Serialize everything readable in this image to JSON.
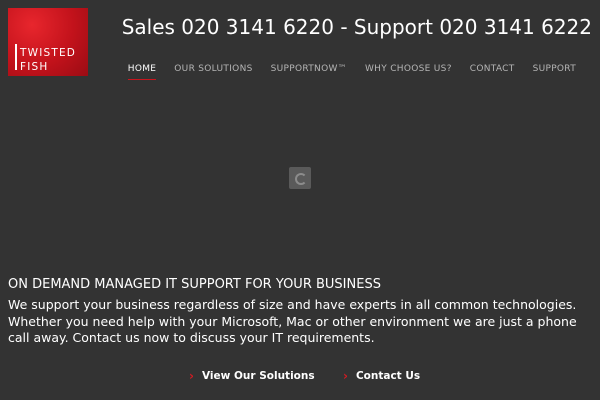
{
  "brand": {
    "logo_line1": "TWISTED",
    "logo_line2": "FISH",
    "color": "#c2121b"
  },
  "header": {
    "phone_text": "Sales 020 3141 6220 - Support 020 3141 6222"
  },
  "nav": {
    "items": [
      {
        "label": "HOME",
        "active": true
      },
      {
        "label": "OUR SOLUTIONS"
      },
      {
        "label": "SUPPORTNOW™"
      },
      {
        "label": "WHY CHOOSE US?"
      },
      {
        "label": "CONTACT"
      },
      {
        "label": "SUPPORT"
      }
    ]
  },
  "hero": {
    "headline": "ON DEMAND MANAGED IT SUPPORT FOR YOUR BUSINESS",
    "description": "We support your business regardless of size and have experts in all common technologies. Whether you need help with your Microsoft, Mac or other environment we are just a phone call away. Contact us now to discuss your IT requirements."
  },
  "cta": {
    "solutions_label": "View Our Solutions",
    "contact_label": "Contact Us",
    "chevron_icon": "chevron-right-icon"
  }
}
